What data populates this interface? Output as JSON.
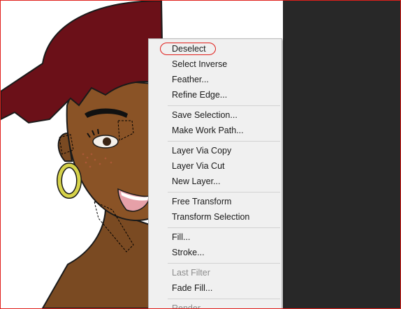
{
  "context_menu": {
    "items": [
      {
        "label": "Deselect",
        "enabled": true
      },
      {
        "label": "Select Inverse",
        "enabled": true
      },
      {
        "label": "Feather...",
        "enabled": true
      },
      {
        "label": "Refine Edge...",
        "enabled": true
      },
      {
        "label": "Save Selection...",
        "enabled": true
      },
      {
        "label": "Make Work Path...",
        "enabled": true
      },
      {
        "label": "Layer Via Copy",
        "enabled": true
      },
      {
        "label": "Layer Via Cut",
        "enabled": true
      },
      {
        "label": "New Layer...",
        "enabled": true
      },
      {
        "label": "Free Transform",
        "enabled": true
      },
      {
        "label": "Transform Selection",
        "enabled": true
      },
      {
        "label": "Fill...",
        "enabled": true
      },
      {
        "label": "Stroke...",
        "enabled": true
      },
      {
        "label": "Last Filter",
        "enabled": false
      },
      {
        "label": "Fade Fill...",
        "enabled": true
      },
      {
        "label": "Render",
        "enabled": false
      }
    ]
  },
  "colors": {
    "annotation": "#e0201c",
    "hair": "#6b1018",
    "skin": "#7a4a22",
    "earring": "#d6d24a",
    "pasteboard": "#282828",
    "menu_background": "#f0f0f0"
  }
}
